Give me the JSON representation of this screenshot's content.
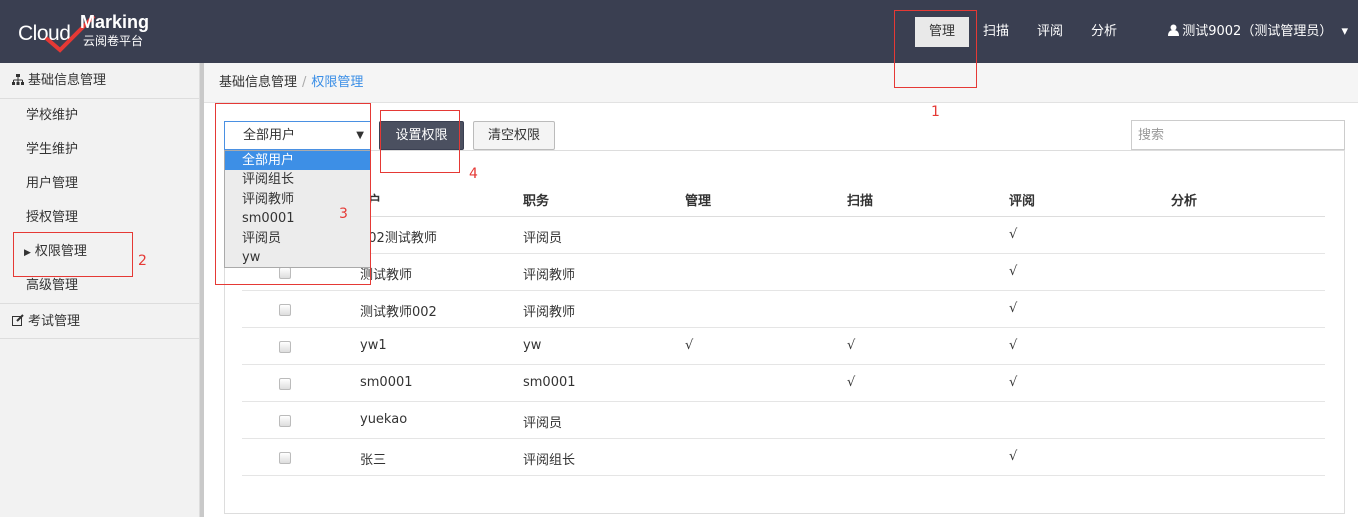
{
  "brand": {
    "cloud": "Cloud",
    "marking": "Marking",
    "subtitle": "云阅卷平台"
  },
  "nav": {
    "manage": "管理",
    "scan": "扫描",
    "review": "评阅",
    "analysis": "分析"
  },
  "user": {
    "name": "测试9002（测试管理员）",
    "caret": "▾"
  },
  "sidebar": {
    "group1": "基础信息管理",
    "items": [
      "学校维护",
      "学生维护",
      "用户管理",
      "授权管理",
      "权限管理",
      "高级管理"
    ],
    "group2": "考试管理"
  },
  "breadcrumb": {
    "root": "基础信息管理",
    "sep": "/",
    "current": "权限管理"
  },
  "toolbar": {
    "filter_value": "全部用户",
    "filter_options": [
      "全部用户",
      "评阅组长",
      "评阅教师",
      "sm0001",
      "评阅员",
      "yw"
    ],
    "set_perm": "设置权限",
    "clear_perm": "清空权限",
    "search_placeholder": "搜索"
  },
  "table": {
    "headers": [
      "户",
      "职务",
      "管理",
      "扫描",
      "评阅",
      "分析"
    ],
    "rows": [
      {
        "user": "002测试教师",
        "role": "评阅员",
        "manage": "",
        "scan": "",
        "review": "√",
        "analysis": ""
      },
      {
        "user": "测试教师",
        "role": "评阅教师",
        "manage": "",
        "scan": "",
        "review": "√",
        "analysis": ""
      },
      {
        "user": "测试教师002",
        "role": "评阅教师",
        "manage": "",
        "scan": "",
        "review": "√",
        "analysis": ""
      },
      {
        "user": "yw1",
        "role": "yw",
        "manage": "√",
        "scan": "√",
        "review": "√",
        "analysis": ""
      },
      {
        "user": "sm0001",
        "role": "sm0001",
        "manage": "",
        "scan": "√",
        "review": "√",
        "analysis": ""
      },
      {
        "user": "yuekao",
        "role": "评阅员",
        "manage": "",
        "scan": "",
        "review": "",
        "analysis": ""
      },
      {
        "user": "张三",
        "role": "评阅组长",
        "manage": "",
        "scan": "",
        "review": "√",
        "analysis": ""
      }
    ]
  },
  "annotations": [
    "1",
    "2",
    "3",
    "4"
  ]
}
